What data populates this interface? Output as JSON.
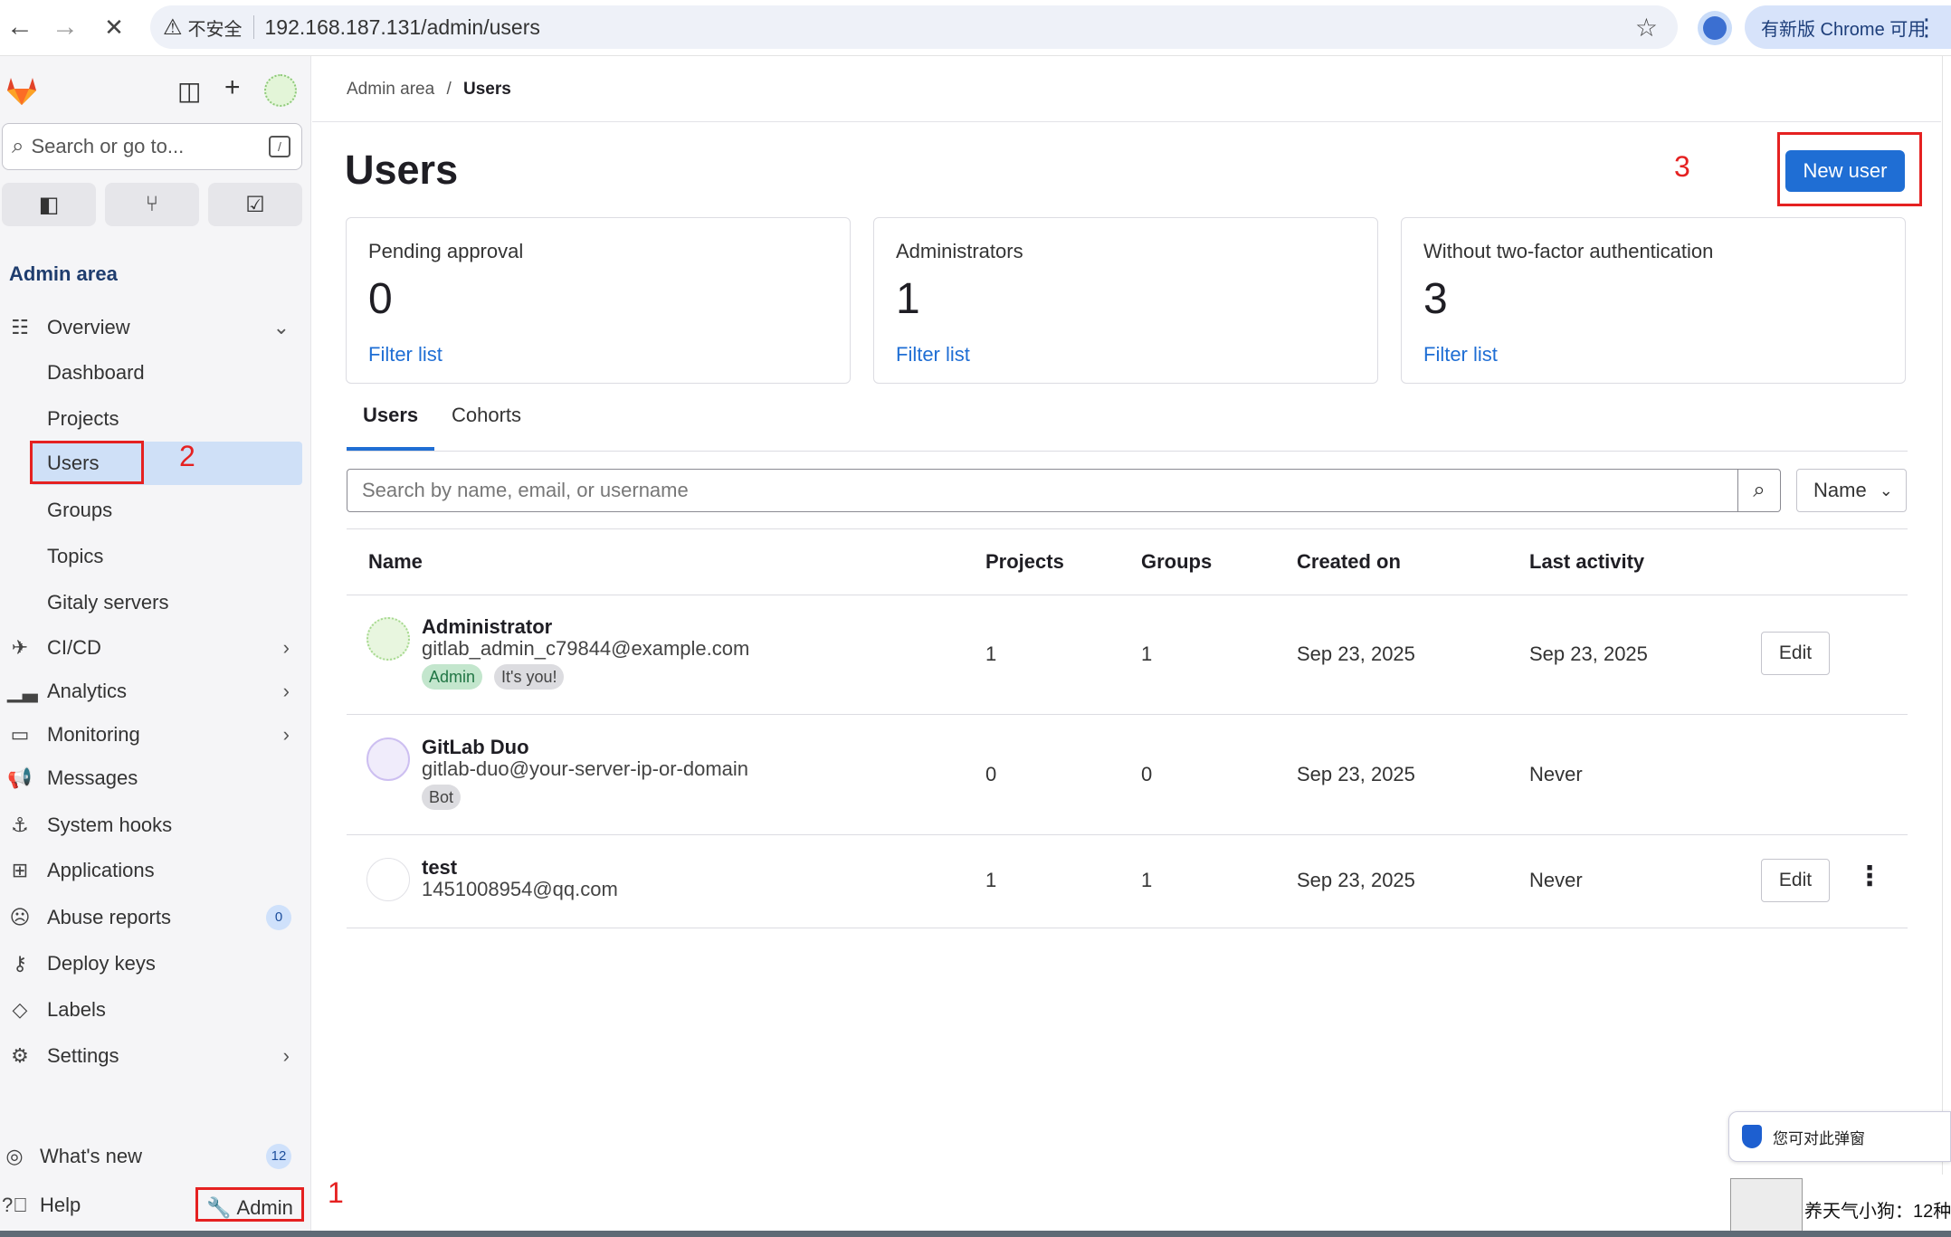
{
  "browser": {
    "back_icon": "←",
    "forward_icon": "→",
    "stop_icon": "✕",
    "insecure_label": "不安全",
    "url": "192.168.187.131/admin/users",
    "update_label": "有新版 Chrome 可用"
  },
  "sidebar": {
    "search_placeholder": "Search or go to...",
    "search_shortcut": "/",
    "section_title": "Admin area",
    "items": [
      {
        "label": "Overview"
      },
      {
        "label": "Dashboard"
      },
      {
        "label": "Projects"
      },
      {
        "label": "Users"
      },
      {
        "label": "Groups"
      },
      {
        "label": "Topics"
      },
      {
        "label": "Gitaly servers"
      },
      {
        "label": "CI/CD"
      },
      {
        "label": "Analytics"
      },
      {
        "label": "Monitoring"
      },
      {
        "label": "Messages"
      },
      {
        "label": "System hooks"
      },
      {
        "label": "Applications"
      },
      {
        "label": "Abuse reports",
        "count": "0"
      },
      {
        "label": "Deploy keys"
      },
      {
        "label": "Labels"
      },
      {
        "label": "Settings"
      }
    ],
    "whats_new": {
      "label": "What's new",
      "count": "12"
    },
    "help": "Help",
    "admin": "Admin"
  },
  "annotations": {
    "one": "1",
    "two": "2",
    "three": "3"
  },
  "main": {
    "breadcrumb": {
      "parent": "Admin area",
      "sep": "/",
      "current": "Users"
    },
    "title": "Users",
    "new_user": "New user",
    "stats": [
      {
        "label": "Pending approval",
        "value": "0",
        "link": "Filter list"
      },
      {
        "label": "Administrators",
        "value": "1",
        "link": "Filter list"
      },
      {
        "label": "Without two-factor authentication",
        "value": "3",
        "link": "Filter list"
      }
    ],
    "tabs": [
      {
        "label": "Users"
      },
      {
        "label": "Cohorts"
      }
    ],
    "search_placeholder": "Search by name, email, or username",
    "sort_label": "Name",
    "columns": [
      "Name",
      "Projects",
      "Groups",
      "Created on",
      "Last activity"
    ],
    "rows": [
      {
        "name": "Administrator",
        "email": "gitlab_admin_c79844@example.com",
        "badges": [
          "Admin",
          "It's you!"
        ],
        "projects": "1",
        "groups": "1",
        "created": "Sep 23, 2025",
        "last": "Sep 23, 2025",
        "action": "Edit"
      },
      {
        "name": "GitLab Duo",
        "email": "gitlab-duo@your-server-ip-or-domain",
        "badges": [
          "Bot"
        ],
        "projects": "0",
        "groups": "0",
        "created": "Sep 23, 2025",
        "last": "Never",
        "action": ""
      },
      {
        "name": "test",
        "email": "1451008954@qq.com",
        "badges": [],
        "projects": "1",
        "groups": "1",
        "created": "Sep 23, 2025",
        "last": "Never",
        "action": "Edit"
      }
    ]
  },
  "overlay": {
    "popup_text": "您可对此弹窗",
    "dog_text": "养天气小狗：12种"
  }
}
